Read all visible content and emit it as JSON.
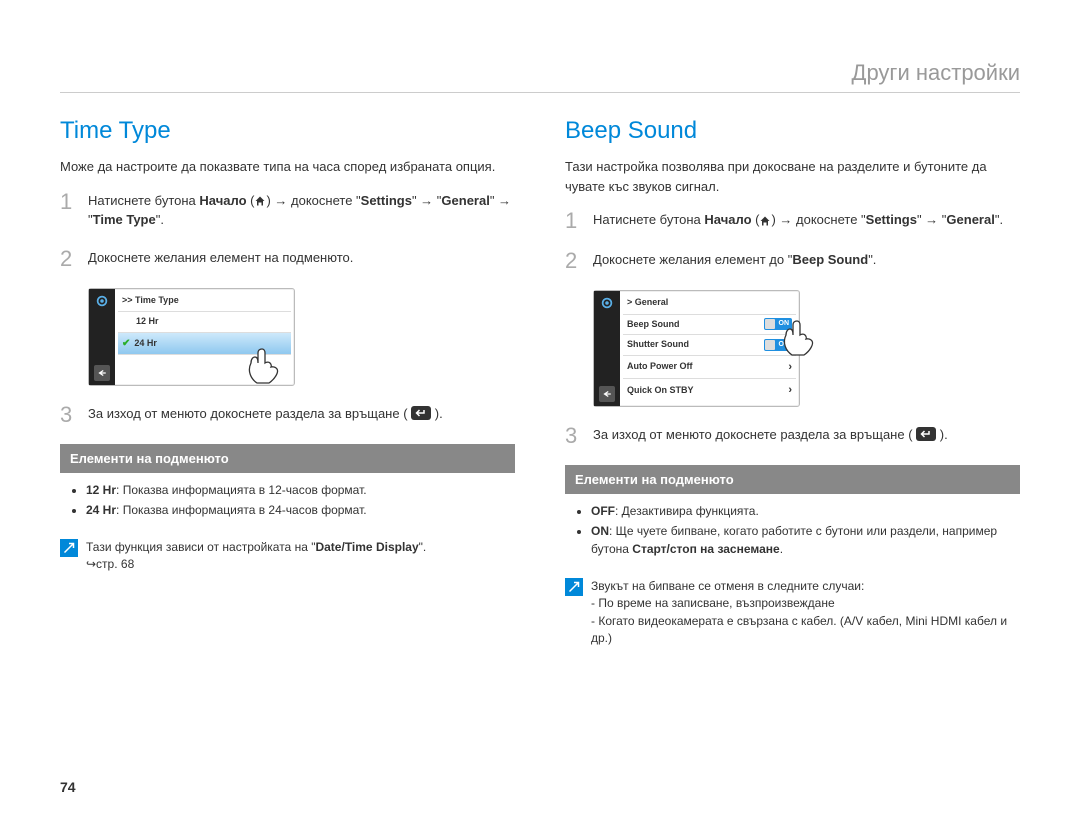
{
  "header": {
    "title": "Други настройки"
  },
  "left": {
    "heading": "Time Type",
    "intro": "Може да настроите да показвате типа на часа според избраната опция.",
    "step1_prefix": "Натиснете бутона ",
    "step1_home": "Начало",
    "step1_mid": " → докоснете \"",
    "step1_settings": "Settings",
    "step1_arrow": "\" → \"",
    "step1_general": "General",
    "step1_arrow2": "\" → \"",
    "step1_timetype": "Time Type",
    "step1_end": "\".",
    "step2": "Докоснете желания елемент на подменюто.",
    "screen": {
      "crumb": ">> Time Type",
      "row1": "12 Hr",
      "row2": "24 Hr"
    },
    "step3_prefix": "За изход от менюто докоснете раздела за връщане ( ",
    "step3_suffix": " ).",
    "submenu_title": "Елементи на подменюто",
    "bullets": [
      {
        "label": "12 Hr",
        "desc": ": Показва информацията в 12-часов формат."
      },
      {
        "label": "24 Hr",
        "desc": ": Показва информацията в 24-часов формат."
      }
    ],
    "note_line1_prefix": "Тази функция зависи от настройката на \"",
    "note_line1_bold": "Date/Time Display",
    "note_line1_suffix": "\".",
    "note_line2": "↪стр. 68"
  },
  "right": {
    "heading": "Beep Sound",
    "intro": "Тази настройка позволява при докосване на разделите и бутоните да чувате къс звуков сигнал.",
    "step1_prefix": "Натиснете бутона ",
    "step1_home": "Начало",
    "step1_mid": " → докоснете \"",
    "step1_settings": "Settings",
    "step1_arrow": "\" → \"",
    "step1_general": "General",
    "step1_end": "\".",
    "step2_prefix": "Докоснете желания елемент до \"",
    "step2_bold": "Beep Sound",
    "step2_suffix": "\".",
    "screen": {
      "crumb": "> General",
      "row1": "Beep Sound",
      "row2": "Shutter Sound",
      "row3": "Auto Power Off",
      "row4": "Quick On STBY",
      "on": "ON"
    },
    "step3_prefix": "За изход от менюто докоснете раздела за връщане ( ",
    "step3_suffix": " ).",
    "submenu_title": "Елементи на подменюто",
    "bullets": [
      {
        "label": "OFF",
        "desc": ": Дезактивира функцията."
      },
      {
        "label": "ON",
        "desc_pre": ": Ще чуете бипване, когато работите с бутони или раздели, например бутона ",
        "desc_bold": "Старт/стоп на заснемане",
        "desc_post": "."
      }
    ],
    "note_lines": [
      "Звукът на бипване се отменя в следните случаи:",
      "- По време на записване, възпроизвеждане",
      "- Когато видеокамерата е свързана с кабел. (A/V кабел, Mini HDMI кабел и др.)"
    ]
  },
  "page": "74"
}
